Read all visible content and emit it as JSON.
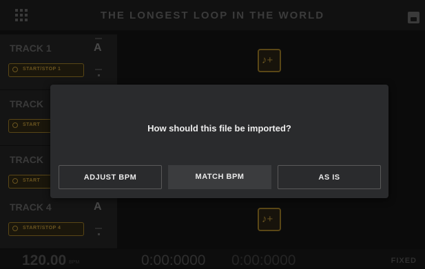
{
  "header": {
    "title": "THE LONGEST LOOP IN THE WORLD"
  },
  "tracks": [
    {
      "name": "TRACK 1",
      "letter": "A",
      "start_stop": "START/STOP 1"
    },
    {
      "name": "TRACK",
      "start_stop": "START"
    },
    {
      "name": "TRACK",
      "start_stop": "START"
    },
    {
      "name": "TRACK 4",
      "letter": "A",
      "start_stop": "START/STOP 4"
    }
  ],
  "footer": {
    "bpm": "120.00",
    "bpm_unit": "BPM",
    "time_current": "0:00:0000",
    "time_total": "0:00:0000",
    "mode": "FIXED"
  },
  "dialog": {
    "message": "How should this file be imported?",
    "buttons": [
      "ADJUST BPM",
      "MATCH BPM",
      "AS IS"
    ]
  },
  "icons": {
    "menu": "grid-menu-icon",
    "save": "save-icon",
    "add_loop": "add-music-icon"
  },
  "colors": {
    "accent": "#6b5520",
    "dialog_bg": "#2a2b2d",
    "background": "#0b0b0b"
  }
}
